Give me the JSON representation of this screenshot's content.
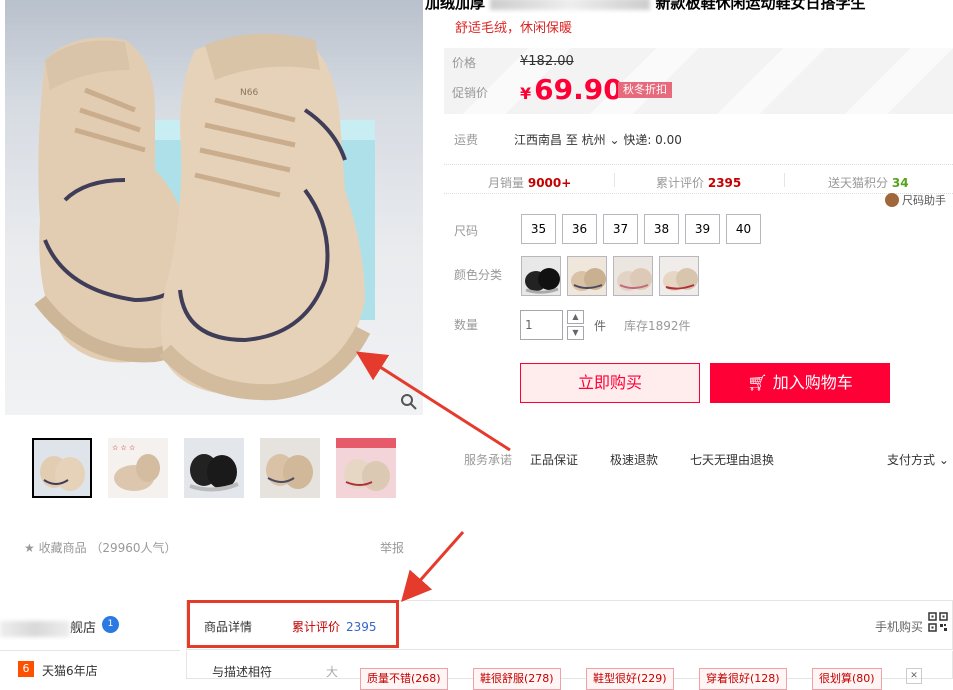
{
  "product": {
    "title_start": "加绒加厚",
    "title_end": "新款板鞋休闲运动鞋女日搭学生",
    "subtitle": "舒适毛绒，休闲保暖",
    "price_label": "价格",
    "original_price": "¥182.00",
    "promo_label": "促销价",
    "currency": "¥",
    "promo_price": "69.90",
    "promo_badge": "秋冬折扣",
    "shipping_label": "运费",
    "shipping_value": "江西南昌 至 杭州 ⌄ 快递: 0.00",
    "stats": {
      "monthly_sales_label": "月销量",
      "monthly_sales": "9000+",
      "reviews_label": "累计评价",
      "reviews": "2395",
      "points_label": "送天猫积分",
      "points": "34"
    },
    "size_help": "尺码助手",
    "size_label": "尺码",
    "sizes": [
      "35",
      "36",
      "37",
      "38",
      "39",
      "40"
    ],
    "color_label": "颜色分类",
    "quantity_label": "数量",
    "quantity": "1",
    "quantity_unit": "件",
    "stock": "库存1892件",
    "buy_now": "立即购买",
    "add_cart": "加入购物车"
  },
  "service": {
    "label": "服务承诺",
    "items": [
      "正品保证",
      "极速退款",
      "七天无理由退换"
    ],
    "payment": "支付方式 ⌄"
  },
  "favorite": "★ 收藏商品 （29960人气）",
  "report": "举报",
  "shop": {
    "name_suffix": "舰店",
    "badge": "1",
    "tmall_years_num": "6",
    "tmall_years": "天猫6年店"
  },
  "tabs": {
    "detail": "商品详情",
    "review": "累计评价",
    "review_count": "2395",
    "mobile": "手机购买"
  },
  "review_summary": {
    "label": "与描述相符",
    "big": "大",
    "tags": [
      "质量不错(268)",
      "鞋很舒服(278)",
      "鞋型很好(229)",
      "穿着很好(128)",
      "很划算(80)"
    ]
  },
  "colors": {
    "accent": "#ff0036",
    "tmall_red": "#c40000",
    "annotation": "#e43b2c"
  }
}
